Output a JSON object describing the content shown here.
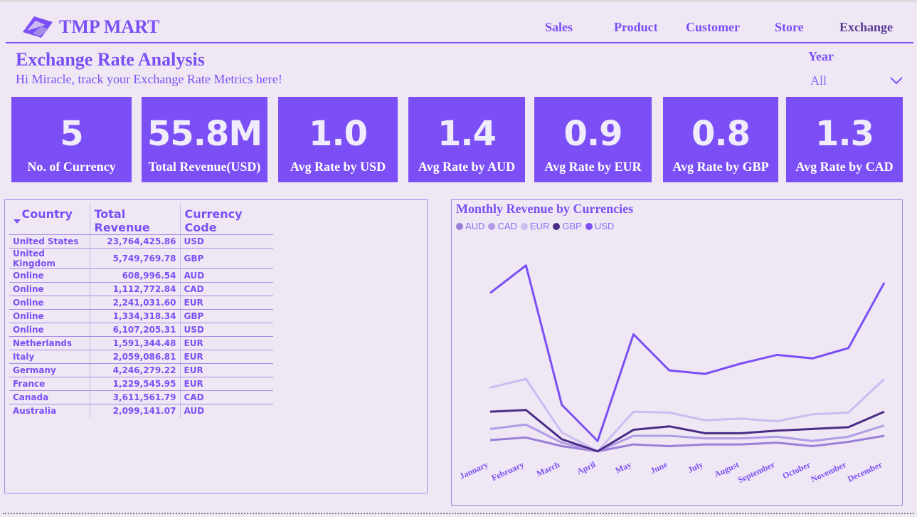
{
  "brand": {
    "name": "TMP MART"
  },
  "nav": [
    "Sales",
    "Product",
    "Customer",
    "Store",
    "Exchange"
  ],
  "page": {
    "title": "Exchange Rate Analysis",
    "subtitle": "Hi Miracle, track your Exchange Rate Metrics here!"
  },
  "filter": {
    "label": "Year",
    "value": "All"
  },
  "kpis": [
    {
      "value": "5",
      "label": "No. of Currency"
    },
    {
      "value": "55.8M",
      "label": "Total Revenue(USD)"
    },
    {
      "value": "1.0",
      "label": "Avg Rate by USD"
    },
    {
      "value": "1.4",
      "label": "Avg Rate by AUD"
    },
    {
      "value": "0.9",
      "label": "Avg Rate by EUR"
    },
    {
      "value": "0.8",
      "label": "Avg Rate by GBP"
    },
    {
      "value": "1.3",
      "label": "Avg Rate by CAD"
    }
  ],
  "table": {
    "columns": [
      "Country",
      "Total Revenue",
      "Currency Code"
    ],
    "rows": [
      [
        "United States",
        "23,764,425.86",
        "USD"
      ],
      [
        "United Kingdom",
        "5,749,769.78",
        "GBP"
      ],
      [
        "Online",
        "608,996.54",
        "AUD"
      ],
      [
        "Online",
        "1,112,772.84",
        "CAD"
      ],
      [
        "Online",
        "2,241,031.60",
        "EUR"
      ],
      [
        "Online",
        "1,334,318.34",
        "GBP"
      ],
      [
        "Online",
        "6,107,205.31",
        "USD"
      ],
      [
        "Netherlands",
        "1,591,344.48",
        "EUR"
      ],
      [
        "Italy",
        "2,059,086.81",
        "EUR"
      ],
      [
        "Germany",
        "4,246,279.22",
        "EUR"
      ],
      [
        "France",
        "1,229,545.95",
        "EUR"
      ],
      [
        "Canada",
        "3,611,561.79",
        "CAD"
      ],
      [
        "Australia",
        "2,099,141.07",
        "AUD"
      ]
    ]
  },
  "chart_data": {
    "type": "line",
    "title": "Monthly Revenue by Currencies",
    "categories": [
      "January",
      "February",
      "March",
      "April",
      "May",
      "June",
      "July",
      "August",
      "September",
      "October",
      "November",
      "December"
    ],
    "series": [
      {
        "name": "AUD",
        "color": "#9a7fd8",
        "values": [
          0.95,
          1.1,
          0.6,
          0.3,
          0.7,
          0.6,
          0.7,
          0.7,
          0.8,
          0.6,
          0.85,
          1.2
        ]
      },
      {
        "name": "CAD",
        "color": "#b29be6",
        "values": [
          1.6,
          1.85,
          0.8,
          0.3,
          1.2,
          1.2,
          1.05,
          1.05,
          1.15,
          0.9,
          1.15,
          1.8
        ]
      },
      {
        "name": "EUR",
        "color": "#cbbcf1",
        "values": [
          4.0,
          4.5,
          1.4,
          0.3,
          2.6,
          2.55,
          2.1,
          2.2,
          2.05,
          2.45,
          2.55,
          4.5
        ]
      },
      {
        "name": "GBP",
        "color": "#4a2c87",
        "values": [
          2.6,
          2.7,
          1.0,
          0.3,
          1.55,
          1.75,
          1.35,
          1.35,
          1.5,
          1.6,
          1.7,
          2.6
        ]
      },
      {
        "name": "USD",
        "color": "#7b4ff5",
        "values": [
          9.5,
          11.1,
          3.0,
          0.9,
          7.1,
          5.0,
          4.8,
          5.4,
          5.9,
          5.7,
          6.3,
          10.1
        ]
      }
    ],
    "xlabel": "",
    "ylabel": "",
    "grid": false,
    "legend": "top-left"
  }
}
